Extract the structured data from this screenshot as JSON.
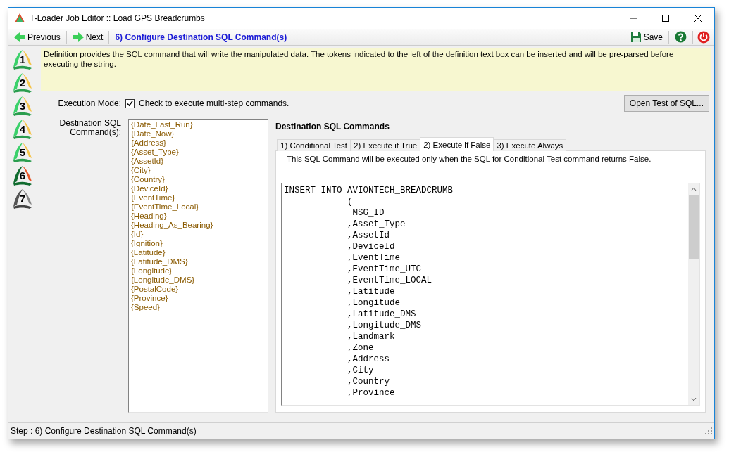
{
  "window": {
    "title": "T-Loader Job Editor :: Load GPS Breadcrumbs"
  },
  "toolbar": {
    "previous": "Previous",
    "next": "Next",
    "step_title": "6) Configure Destination SQL Command(s)",
    "save": "Save"
  },
  "steps": [
    {
      "label": "1",
      "kind": "done"
    },
    {
      "label": "2",
      "kind": "done"
    },
    {
      "label": "3",
      "kind": "done"
    },
    {
      "label": "4",
      "kind": "done"
    },
    {
      "label": "5",
      "kind": "done"
    },
    {
      "label": "6",
      "kind": "current"
    },
    {
      "label": "7",
      "kind": "pending"
    }
  ],
  "description": "Definition provides the SQL command that will write the manipulated data. The tokens indicated to the left of the definition text box can be inserted and will be pre-parsed before executing the string.",
  "execution_mode": {
    "label": "Execution Mode:",
    "checkbox_label": "Check to execute multi-step commands.",
    "checked": true
  },
  "open_test_button": "Open Test of SQL...",
  "tokens": {
    "label": "Destination SQL Command(s):",
    "items": [
      "{Date_Last_Run}",
      "{Date_Now}",
      "{Address}",
      "{Asset_Type}",
      "{AssetId}",
      "{City}",
      "{Country}",
      "{DeviceId}",
      "{EventTime}",
      "{EventTime_Local}",
      "{Heading}",
      "{Heading_As_Bearing}",
      "{Id}",
      "{Ignition}",
      "{Latitude}",
      "{Latitude_DMS}",
      "{Longitude}",
      "{Longitude_DMS}",
      "{PostalCode}",
      "{Province}",
      "{Speed}"
    ]
  },
  "commands": {
    "heading": "Destination SQL Commands",
    "tabs": [
      {
        "label": "1) Conditional Test",
        "selected": false
      },
      {
        "label": "2) Execute if True",
        "selected": false
      },
      {
        "label": "2) Execute if False",
        "selected": true
      },
      {
        "label": "3) Execute Always",
        "selected": false
      }
    ],
    "tab_description": "This SQL Command will be executed only when the SQL for Conditional Test command returns False.",
    "sql_lines": [
      "INSERT INTO AVIONTECH_BREADCRUMB",
      "            (",
      "             MSG_ID",
      "            ,Asset_Type",
      "            ,AssetId",
      "            ,DeviceId",
      "            ,EventTime",
      "            ,EventTime_UTC",
      "            ,EventTime_LOCAL",
      "            ,Latitude",
      "            ,Longitude",
      "            ,Latitude_DMS",
      "            ,Longitude_DMS",
      "            ,Landmark",
      "            ,Zone",
      "            ,Address",
      "            ,City",
      "            ,Country",
      "            ,Province"
    ]
  },
  "status_bar": "Step : 6) Configure Destination SQL Command(s)"
}
